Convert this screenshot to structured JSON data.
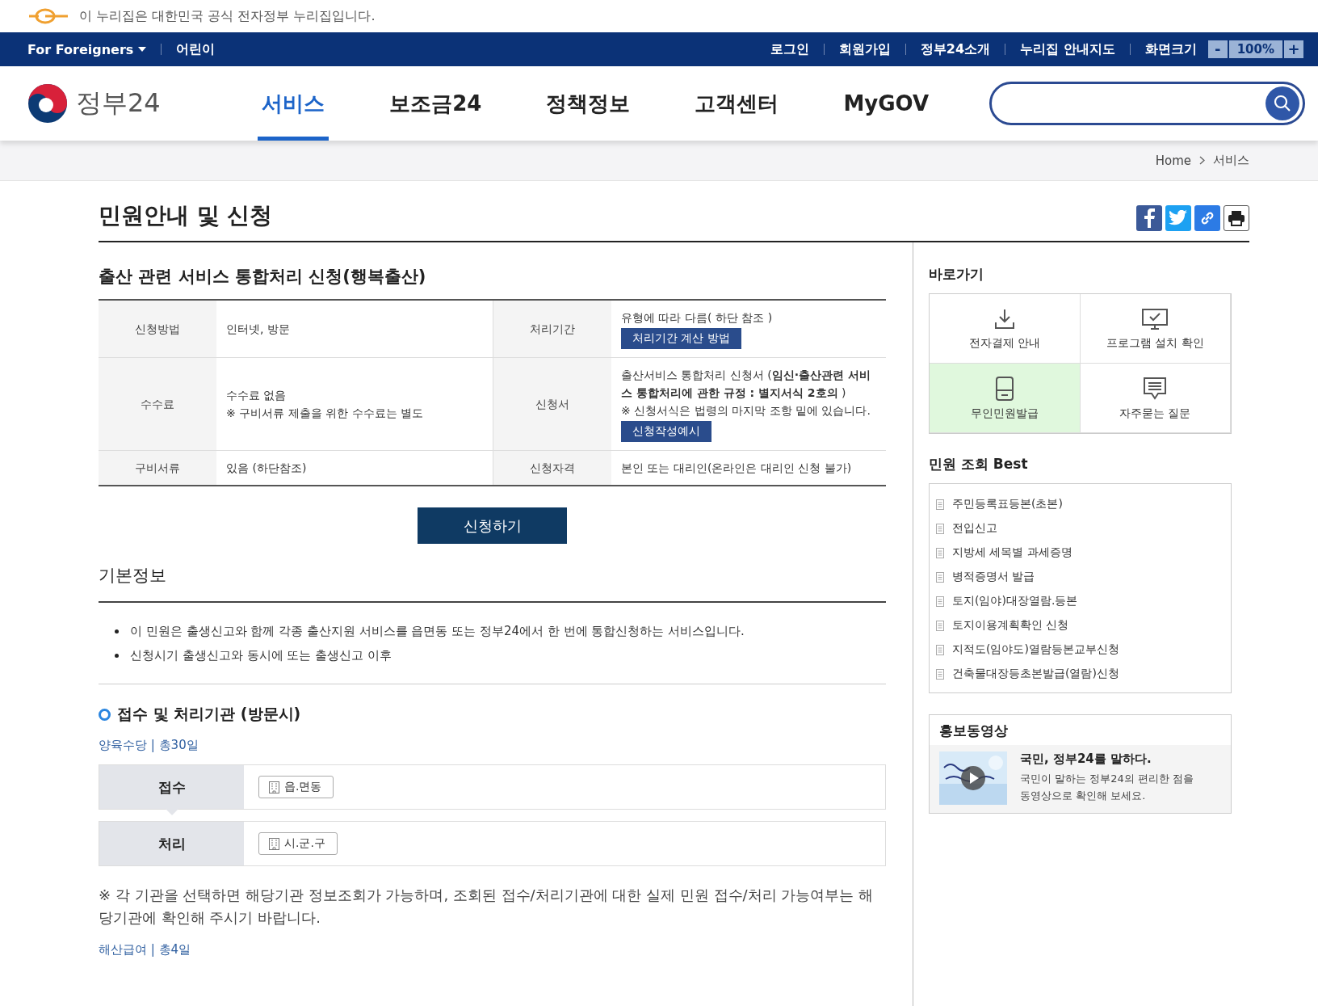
{
  "notice_bar": {
    "text": "이 누리집은 대한민국 공식 전자정부 누리집입니다."
  },
  "top_bar": {
    "left": [
      {
        "label": "For Foreigners",
        "kind": "dropdown"
      },
      {
        "label": "어린이",
        "kind": "link"
      }
    ],
    "right": [
      "로그인",
      "회원가입",
      "정부24소개",
      "누리집 안내지도"
    ],
    "zoom": {
      "label": "화면크기",
      "minus": "-",
      "value": "100%",
      "plus": "+"
    }
  },
  "header": {
    "logo_text": "정부24",
    "nav": [
      {
        "label": "서비스",
        "selected": true
      },
      {
        "label": "보조금24",
        "selected": false
      },
      {
        "label": "정책정보",
        "selected": false
      },
      {
        "label": "고객센터",
        "selected": false
      },
      {
        "label": "MyGOV",
        "selected": false
      }
    ]
  },
  "breadcrumb": [
    "Home",
    "서비스"
  ],
  "page_title": "민원안내 및 신청",
  "service_title": "출산 관련 서비스 통합처리 신청(행복출산)",
  "info_table": [
    {
      "cells": [
        {
          "label": "신청방법",
          "lines": [
            "인터넷, 방문"
          ]
        },
        {
          "label": "처리기간",
          "lines": [
            "유형에 따라 다름( 하단 참조 )"
          ],
          "button": "처리기간 계산 방법"
        }
      ]
    },
    {
      "cells": [
        {
          "label": "수수료",
          "lines": [
            "수수료 없음",
            "※ 구비서류 제출을 위한 수수료는 별도"
          ]
        },
        {
          "label": "신청서",
          "lines": [
            "출산서비스 통합처리 신청서 (**임신·출산관련 서비스 통합처리에 관한 규정 : 별지서식 2호의** )",
            "※ 신청서식은 법령의 마지막 조항 밑에 있습니다."
          ],
          "button": "신청작성예시"
        }
      ]
    },
    {
      "cells": [
        {
          "label": "구비서류",
          "lines": [
            "있음 (하단참조)"
          ]
        },
        {
          "label": "신청자격",
          "lines": [
            "본인 또는 대리인(온라인은 대리인 신청 불가)"
          ]
        }
      ]
    }
  ],
  "apply_button": "신청하기",
  "basic_info": {
    "title": "기본정보",
    "bullets": [
      "이 민원은 출생신고와 함께 각종 출산지원 서비스를 읍면동 또는 정부24에서 한 번에 통합신청하는 서비스입니다.",
      "신청시기 출생신고와 동시에 또는 출생신고 이후"
    ]
  },
  "agencies": {
    "title": "접수 및 처리기관 (방문시)",
    "groups": [
      {
        "link": "양육수당 | 총30일",
        "steps": [
          {
            "label": "접수",
            "office": "읍.면동"
          },
          {
            "label": "처리",
            "office": "시.군.구"
          }
        ],
        "note": "※ 각 기관을 선택하면 해당기관 정보조회가 가능하며, 조회된 접수/처리기관에 대한 실제 민원 접수/처리 가능여부는 해당기관에 확인해 주시기 바랍니다."
      },
      {
        "link": "해산급여 | 총4일"
      }
    ]
  },
  "sidebar": {
    "shortcuts": {
      "title": "바로가기",
      "items": [
        {
          "label": "전자결제 안내",
          "kind": "download",
          "highlighted": false
        },
        {
          "label": "프로그램 설치 확인",
          "kind": "monitor",
          "highlighted": false
        },
        {
          "label": "무인민원발급",
          "kind": "kiosk",
          "highlighted": true
        },
        {
          "label": "자주묻는 질문",
          "kind": "chat",
          "highlighted": false
        }
      ]
    },
    "best": {
      "title": "민원 조회 Best",
      "items": [
        "주민등록표등본(초본)",
        "전입신고",
        "지방세 세목별 과세증명",
        "병적증명서 발급",
        "토지(임야)대장열람.등본",
        "토지이용계획확인 신청",
        "지적도(임야도)열람등본교부신청",
        "건축물대장등초본발급(열람)신청"
      ]
    },
    "video": {
      "title": "홍보동영상",
      "headline": "국민, 정부24를 말하다.",
      "description": "국민이 말하는 정부24의 편리한 점을 동영상으로 확인해 보세요."
    }
  }
}
